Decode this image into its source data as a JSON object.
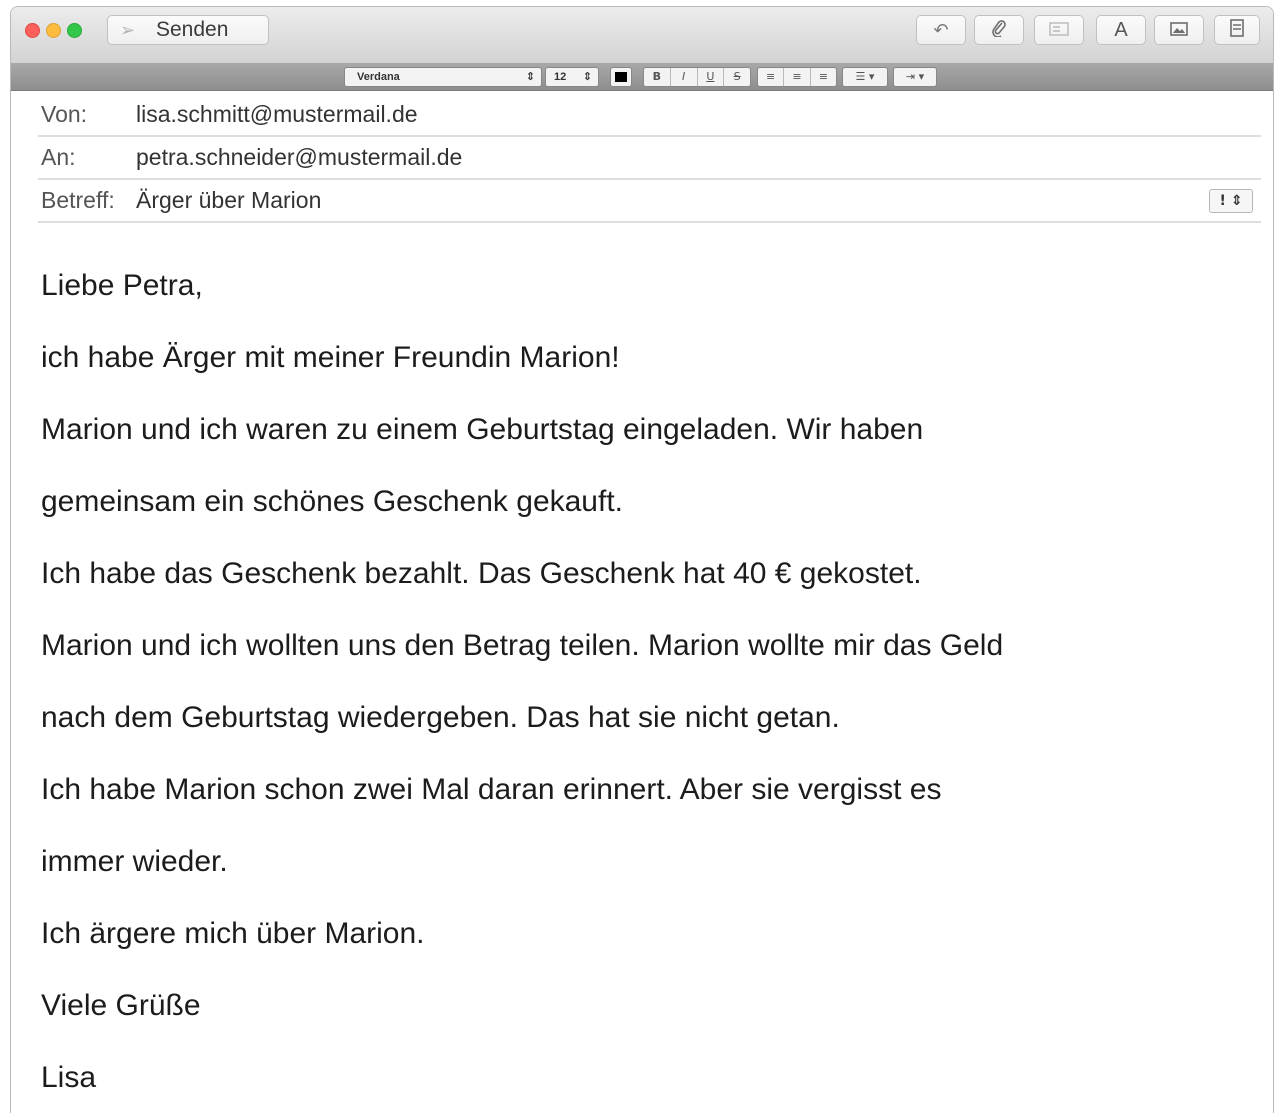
{
  "toolbar": {
    "send_label": "Senden",
    "icons": {
      "send": "send-arrow",
      "reply": "reply-arrow",
      "attach": "paperclip",
      "header": "header-card",
      "fonts": "letter-a",
      "photo": "photo",
      "template": "stationery"
    },
    "fonts_glyph": "A"
  },
  "format_bar": {
    "font": "Verdana",
    "size": "12",
    "text_color": "#000000",
    "style_buttons": [
      "B",
      "I",
      "U",
      "S"
    ],
    "align_buttons": [
      "≡",
      "≡",
      "≡"
    ],
    "list_button": "☰ ▾",
    "indent_button": "⇥ ▾"
  },
  "header": {
    "from_label": "Von:",
    "from_value": "lisa.schmitt@mustermail.de",
    "to_label": "An:",
    "to_value": "petra.schneider@mustermail.de",
    "subject_label": "Betreff:",
    "subject_value": "Ärger über Marion",
    "priority_glyph": "! ⇕"
  },
  "body_lines": [
    "Liebe Petra,",
    "ich habe Ärger mit meiner Freundin Marion!",
    "Marion und ich waren zu einem Geburtstag eingeladen. Wir haben",
    "gemeinsam ein schönes Geschenk gekauft.",
    "Ich habe das Geschenk bezahlt. Das Geschenk hat 40 € gekostet.",
    "Marion und ich wollten uns den Betrag teilen. Marion wollte mir das Geld",
    "nach dem Geburtstag wiedergeben. Das hat sie nicht getan.",
    "Ich habe Marion schon zwei Mal daran erinnert. Aber sie vergisst es",
    "immer wieder.",
    "Ich ärgere mich über Marion.",
    "Viele Grüße",
    "Lisa"
  ]
}
